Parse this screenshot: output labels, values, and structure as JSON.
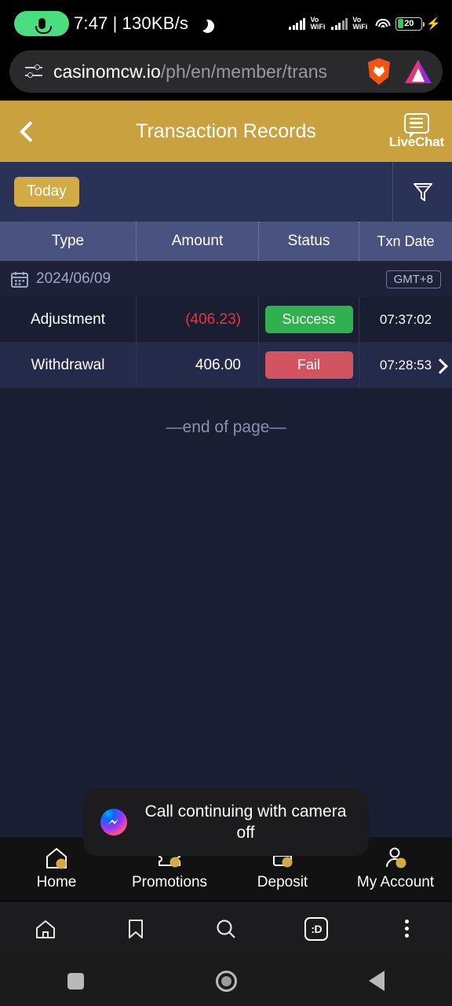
{
  "status_bar": {
    "mic_icon": "microphone-icon",
    "time": "7:47",
    "separator": "|",
    "network_speed": "130KB/s",
    "moon_icon": "crescent-moon-icon",
    "sim1_label": "Vo\nWiFi",
    "sim1_line1": "Vo",
    "sim1_line2": "WiFi",
    "sim2_line1": "Vo",
    "sim2_line2": "WiFi",
    "wifi_icon": "wifi-icon",
    "battery_percent": "20",
    "charging_icon": "lightning-bolt-icon"
  },
  "browser": {
    "tune_icon": "tune-settings-icon",
    "url_domain": "casinomcw.io",
    "url_path": "/ph/en/member/trans",
    "shield_icon": "brave-lion-shield-icon",
    "brave_logo_icon": "brave-triangle-logo-icon",
    "toolbar": {
      "home_icon": "home-icon",
      "bookmark_icon": "bookmark-icon",
      "search_icon": "search-icon",
      "tabs_label": ":D",
      "menu_icon": "kebab-menu-icon"
    }
  },
  "app_header": {
    "back_icon": "chevron-left-icon",
    "title": "Transaction Records",
    "livechat_icon": "chat-bubble-icon",
    "livechat_label": "LiveChat",
    "background_color": "#c9a23f"
  },
  "filter_bar": {
    "today_label": "Today",
    "filter_icon": "funnel-filter-icon",
    "pill_color": "#d3ab45"
  },
  "table": {
    "columns": [
      "Type",
      "Amount",
      "Status",
      "Txn Date"
    ],
    "date_group": {
      "calendar_icon": "calendar-icon",
      "date": "2024/06/09",
      "timezone_badge": "GMT+8"
    },
    "rows": [
      {
        "type": "Adjustment",
        "amount": "(406.23)",
        "amount_negative": true,
        "status": "Success",
        "status_color": "#2eb14e",
        "time": "07:37:02",
        "has_chevron": false
      },
      {
        "type": "Withdrawal",
        "amount": "406.00",
        "amount_negative": false,
        "status": "Fail",
        "status_color": "#d25460",
        "time": "07:28:53",
        "has_chevron": true,
        "chevron_icon": "chevron-right-icon"
      }
    ],
    "end_of_page": "—end of page—"
  },
  "toast": {
    "app_icon": "messenger-icon",
    "message": "Call continuing with camera off"
  },
  "site_nav": {
    "items": [
      {
        "label": "Home",
        "icon": "home-coin-icon"
      },
      {
        "label": "Promotions",
        "icon": "ticket-coin-icon"
      },
      {
        "label": "Deposit",
        "icon": "card-coin-icon"
      },
      {
        "label": "My Account",
        "icon": "user-coin-icon"
      }
    ]
  },
  "android_nav": {
    "recents_icon": "square-recents-icon",
    "home_icon": "circle-home-icon",
    "back_icon": "triangle-back-icon"
  }
}
